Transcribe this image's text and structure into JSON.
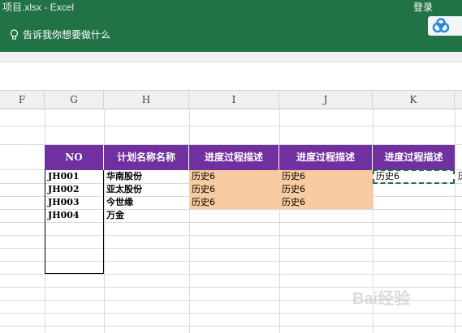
{
  "window": {
    "title": "项目.xlsx  -  Excel",
    "login_label": "登录"
  },
  "ribbon": {
    "tell_me": "告诉我你想要做什么"
  },
  "columns": [
    "F",
    "G",
    "H",
    "I",
    "J",
    "K"
  ],
  "table": {
    "headers": [
      "NO",
      "计划名称名称",
      "进度过程描述",
      "进度过程描述",
      "进度过程描述"
    ],
    "rows": [
      {
        "no": "JH001",
        "name": "华南股份",
        "i": "历史6",
        "j": "历史6",
        "k": "历史6"
      },
      {
        "no": "JH002",
        "name": "亚太股份",
        "i": "历史6",
        "j": "历史6",
        "k": ""
      },
      {
        "no": "JH003",
        "name": "今世缘",
        "i": "历史6",
        "j": "历史6",
        "k": ""
      },
      {
        "no": "JH004",
        "name": "万金",
        "i": "",
        "j": "",
        "k": ""
      }
    ],
    "overflow_text": "历"
  },
  "colors": {
    "ribbon": "#217346",
    "header_fill": "#7030a0",
    "highlight_fill": "#f8cba0"
  },
  "watermark": "Bai经验"
}
